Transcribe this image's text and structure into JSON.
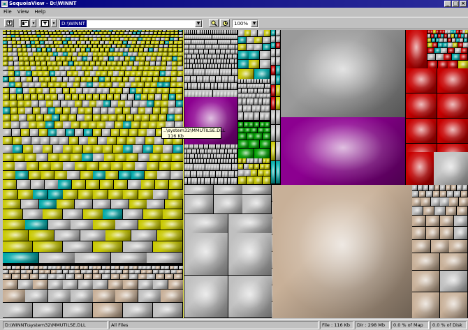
{
  "window": {
    "title": "SequoiaView - D:\\WINNT"
  },
  "menu": {
    "items": [
      "File",
      "View",
      "Help"
    ]
  },
  "toolbar": {
    "path_value": "D:\\WINNT",
    "zoom_value": "100%",
    "buttons": [
      "up-icon",
      "view-icon",
      "filter-icon",
      "search-icon",
      "refresh-icon"
    ]
  },
  "tooltip": {
    "line1": "..\\system32\\MMUTILSE.DLL",
    "line2": "116 Kb"
  },
  "status": {
    "path": "D:\\WINNT\\system32\\MMUTILSE.DLL",
    "filter": "All Files",
    "file_size": "File : 116 Kb",
    "dir_size": "Dir : 298 Mb",
    "map_pct": "0.0 % of Map",
    "disk_pct": "0.0 % of Disk"
  },
  "colors": {
    "yellow": "#c8c800",
    "teal": "#00a8a8",
    "grey": "#c0c0c0",
    "purple": "#8c0090",
    "green": "#00a000",
    "red": "#c80000",
    "tan": "#c8b098",
    "navy": "#000080"
  }
}
